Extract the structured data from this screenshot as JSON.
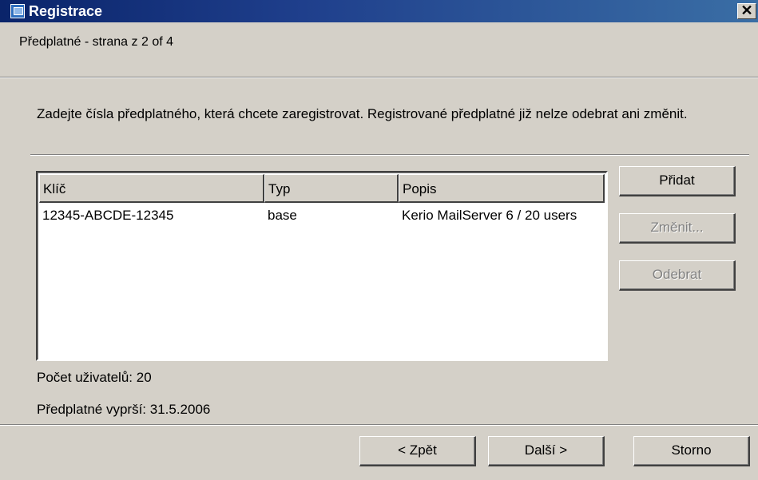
{
  "window": {
    "title": "Registrace",
    "close_glyph": "✕"
  },
  "header": {
    "page_title": "Předplatné - strana z 2 of 4"
  },
  "instructions": "Zadejte čísla předplatného, která chcete zaregistrovat. Registrované předplatné již nelze odebrat ani změnit.",
  "list": {
    "columns": [
      "Klíč",
      "Typ",
      "Popis"
    ],
    "rows": [
      {
        "key": "12345-ABCDE-12345",
        "type": "base",
        "description": "Kerio MailServer 6 / 20 users"
      }
    ]
  },
  "side_buttons": {
    "add": "Přidat",
    "change": "Změnit...",
    "remove": "Odebrat"
  },
  "info": {
    "user_count": "Počet uživatelů:  20",
    "expiry": "Předplatné vyprší:  31.5.2006"
  },
  "nav_buttons": {
    "back": "< Zpět",
    "next": "Další >",
    "cancel": "Storno"
  },
  "icons": {
    "title_icon": "registration-app-icon"
  }
}
